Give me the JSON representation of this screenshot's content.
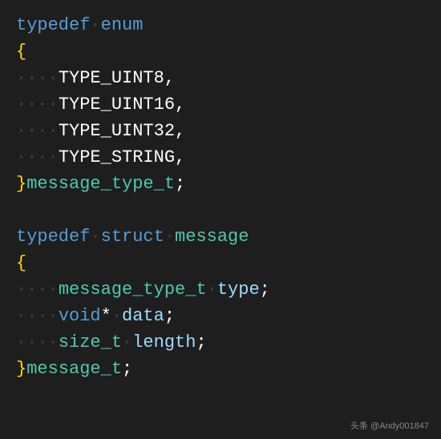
{
  "code": {
    "line1": {
      "keyword1": "typedef",
      "space1": "·",
      "keyword2": "enum"
    },
    "line2": {
      "brace": "{"
    },
    "line3": {
      "indent": "····",
      "value": "TYPE_UINT8",
      "comma": ","
    },
    "line4": {
      "indent": "····",
      "value": "TYPE_UINT16",
      "comma": ","
    },
    "line5": {
      "indent": "····",
      "value": "TYPE_UINT32",
      "comma": ","
    },
    "line6": {
      "indent": "····",
      "value": "TYPE_STRING",
      "comma": ","
    },
    "line7": {
      "brace": "}",
      "typename": "message_type_t",
      "semi": ";"
    },
    "line8": {
      "blank": ""
    },
    "line9": {
      "keyword1": "typedef",
      "space1": "·",
      "keyword2": "struct",
      "space2": "·",
      "typename": "message"
    },
    "line10": {
      "brace": "{"
    },
    "line11": {
      "indent": "····",
      "type": "message_type_t",
      "space": "·",
      "var": "type",
      "semi": ";"
    },
    "line12": {
      "indent": "····",
      "type": "void",
      "ptr": "*",
      "space": "·",
      "var": "data",
      "semi": ";"
    },
    "line13": {
      "indent": "····",
      "type": "size_t",
      "space": "·",
      "var": "length",
      "semi": ";"
    },
    "line14": {
      "brace": "}",
      "typename": "message_t",
      "semi": ";"
    }
  },
  "watermark": "头条 @Andy001847"
}
